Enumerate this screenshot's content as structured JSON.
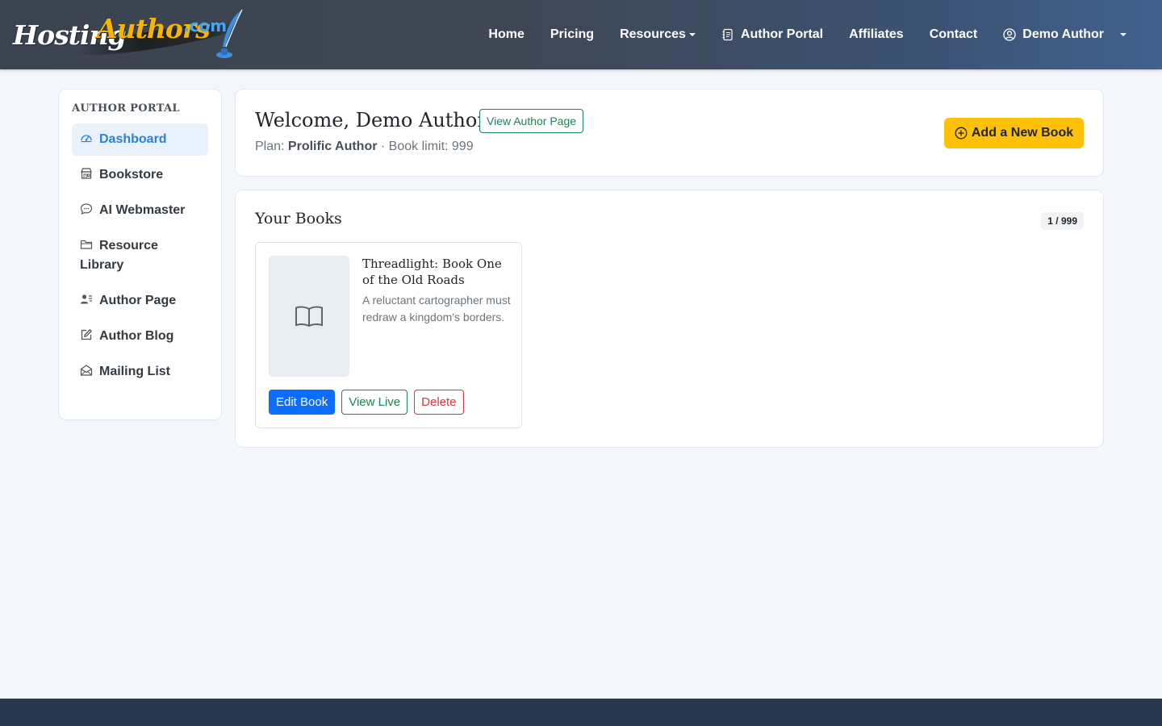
{
  "brand": {
    "logo_text_1": "Hosting",
    "logo_text_2": "Authors",
    "logo_text_3": ".com"
  },
  "nav": {
    "home": "Home",
    "pricing": "Pricing",
    "resources": "Resources",
    "author_portal": "Author Portal",
    "affiliates": "Affiliates",
    "contact": "Contact",
    "user": "Demo Author"
  },
  "sidebar": {
    "title": "AUTHOR PORTAL",
    "items": [
      {
        "label": "Dashboard",
        "icon": "speedometer-icon",
        "active": true
      },
      {
        "label": "Bookstore",
        "icon": "shop-icon"
      },
      {
        "label": "AI Webmaster",
        "icon": "chat-icon"
      },
      {
        "label": "Resource Library",
        "icon": "folder-icon"
      },
      {
        "label": "Author Page",
        "icon": "person-lines-icon"
      },
      {
        "label": "Author Blog",
        "icon": "pencil-square-icon"
      },
      {
        "label": "Mailing List",
        "icon": "envelope-open-icon"
      }
    ]
  },
  "welcome": {
    "title": "Welcome, Demo Author",
    "view_author_page": "View Author Page",
    "plan_label": "Plan:",
    "plan_name": "Prolific Author",
    "book_limit_text": "· Book limit: 999",
    "add_book": "Add a New Book"
  },
  "books": {
    "title": "Your Books",
    "count": "1 / 999",
    "items": [
      {
        "title": "Threadlight: Book One of the Old Roads",
        "description": "A reluctant cartographer must redraw a kingdom's borders.",
        "edit": "Edit Book",
        "view": "View Live",
        "delete": "Delete"
      }
    ]
  },
  "colors": {
    "accent_blue": "#2f80d8",
    "warning_yellow": "#ffc107",
    "primary_blue": "#0d6efd",
    "success_green": "#198754",
    "danger_red": "#dc3545",
    "footer": "#28374c"
  }
}
